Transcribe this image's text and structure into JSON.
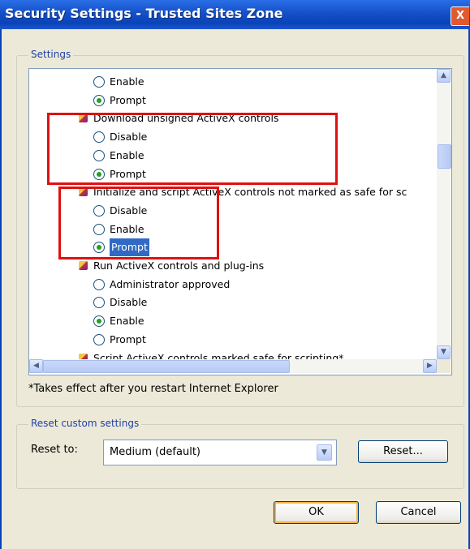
{
  "window": {
    "title": "Security Settings - Trusted Sites Zone",
    "close_glyph": "X"
  },
  "settings": {
    "group_label": "Settings",
    "rows": [
      {
        "kind": "radio",
        "label": "Enable",
        "checked": false
      },
      {
        "kind": "radio",
        "label": "Prompt",
        "checked": true
      },
      {
        "kind": "category",
        "label": "Download unsigned ActiveX controls",
        "icon": "activex-category-icon"
      },
      {
        "kind": "radio",
        "label": "Disable",
        "checked": false
      },
      {
        "kind": "radio",
        "label": "Enable",
        "checked": false
      },
      {
        "kind": "radio",
        "label": "Prompt",
        "checked": true
      },
      {
        "kind": "category",
        "label": "Initialize and script ActiveX controls not marked as safe for sc",
        "icon": "activex-category-icon"
      },
      {
        "kind": "radio",
        "label": "Disable",
        "checked": false
      },
      {
        "kind": "radio",
        "label": "Enable",
        "checked": false
      },
      {
        "kind": "radio",
        "label": "Prompt",
        "checked": true,
        "selected": true
      },
      {
        "kind": "category",
        "label": "Run ActiveX controls and plug-ins",
        "icon": "activex-category-icon"
      },
      {
        "kind": "radio",
        "label": "Administrator approved",
        "checked": false
      },
      {
        "kind": "radio",
        "label": "Disable",
        "checked": false
      },
      {
        "kind": "radio",
        "label": "Enable",
        "checked": true
      },
      {
        "kind": "radio",
        "label": "Prompt",
        "checked": false
      },
      {
        "kind": "category",
        "label": "Script ActiveX controls marked safe for scripting*",
        "icon": "activex-category-icon"
      }
    ],
    "restart_note": "*Takes effect after you restart Internet Explorer"
  },
  "reset": {
    "group_label": "Reset custom settings",
    "reset_to_label": "Reset to:",
    "selected_level": "Medium (default)",
    "reset_button": "Reset..."
  },
  "footer": {
    "ok_label": "OK",
    "cancel_label": "Cancel"
  },
  "colors": {
    "titlebar": "#1550c8",
    "dialog_bg": "#ece9d8",
    "highlight_box": "#e01010",
    "selection": "#316ac5",
    "radio_dot": "#21a121"
  }
}
